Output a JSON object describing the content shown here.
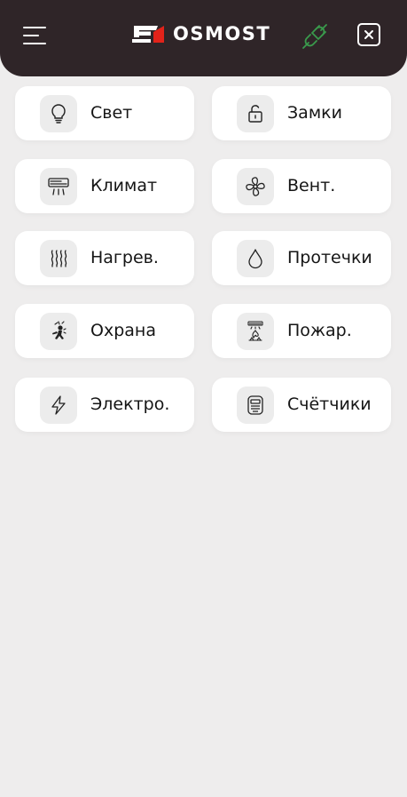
{
  "header": {
    "brand": "OSMOST",
    "colors": {
      "bar": "#2f2528",
      "logo_accent": "#e2231a",
      "plug": "#3a9a4c"
    }
  },
  "tiles": [
    {
      "label": "Свет",
      "icon": "lightbulb-icon"
    },
    {
      "label": "Замки",
      "icon": "lock-icon"
    },
    {
      "label": "Климат",
      "icon": "air-conditioner-icon"
    },
    {
      "label": "Вент.",
      "icon": "fan-icon"
    },
    {
      "label": "Нагрев.",
      "icon": "heat-waves-icon"
    },
    {
      "label": "Протечки",
      "icon": "water-drop-icon"
    },
    {
      "label": "Охрана",
      "icon": "intruder-icon"
    },
    {
      "label": "Пожар.",
      "icon": "fire-alarm-icon"
    },
    {
      "label": "Электро.",
      "icon": "lightning-icon"
    },
    {
      "label": "Счётчики",
      "icon": "meter-icon"
    }
  ]
}
